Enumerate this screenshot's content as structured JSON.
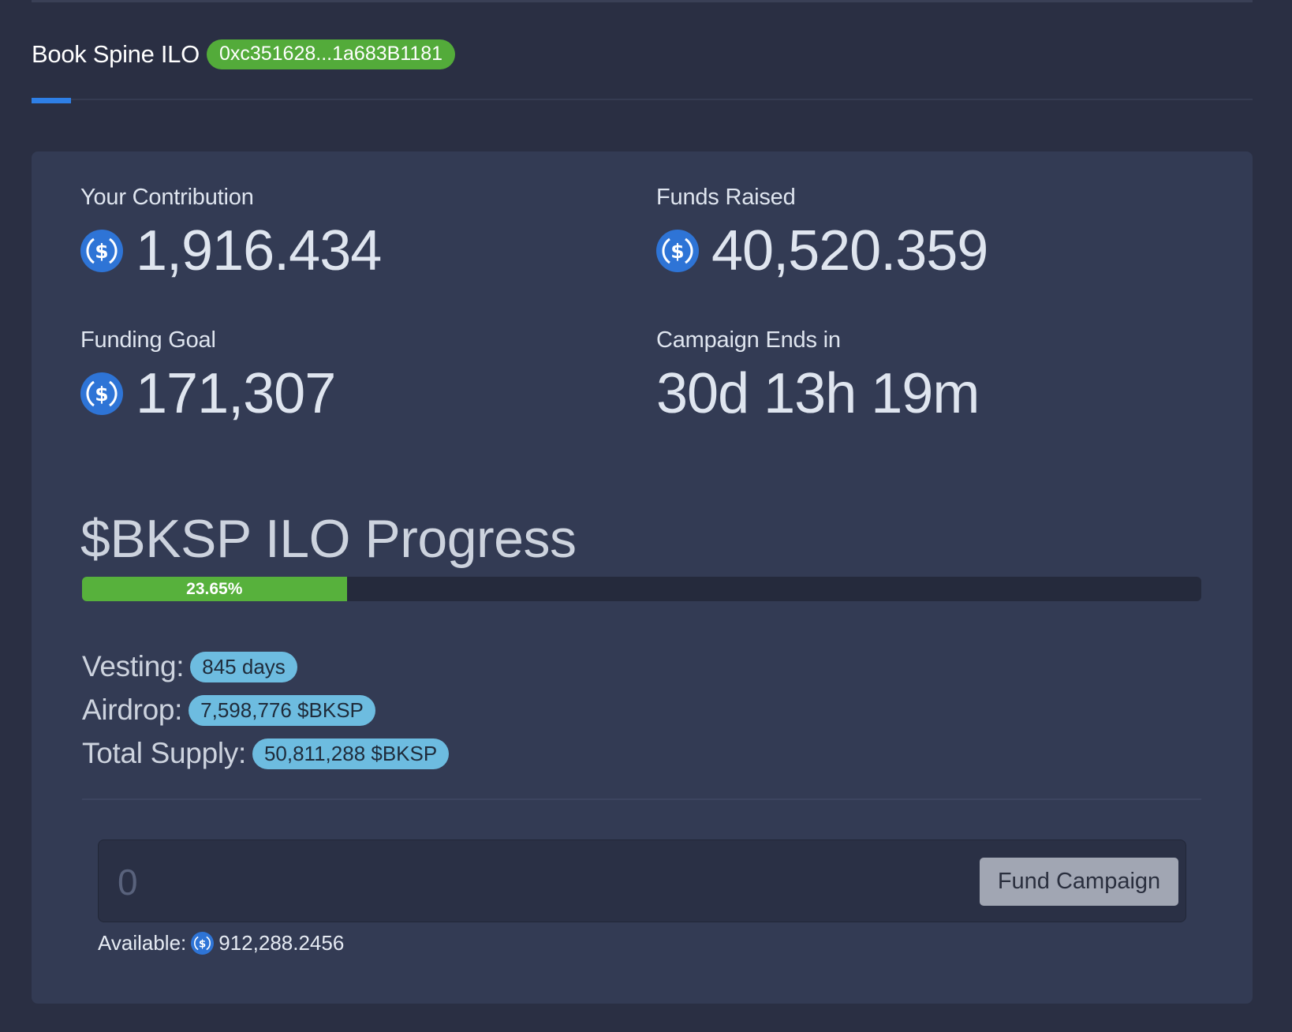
{
  "header": {
    "title": "Book Spine ILO",
    "address": "0xc351628...1a683B1181",
    "badge_color": "#53ab3a",
    "accent_color": "#2e7fe6"
  },
  "stats": {
    "contribution": {
      "label": "Your Contribution",
      "value": "1,916.434",
      "icon": "usdc-coin-icon"
    },
    "funds_raised": {
      "label": "Funds Raised",
      "value": "40,520.359",
      "icon": "usdc-coin-icon"
    },
    "funding_goal": {
      "label": "Funding Goal",
      "value": "171,307",
      "icon": "usdc-coin-icon"
    },
    "campaign_ends": {
      "label": "Campaign Ends in",
      "value": "30d 13h 19m"
    }
  },
  "progress": {
    "title": "$BKSP ILO Progress",
    "percent": 23.65,
    "label": "23.65%",
    "fill_color": "#57b13c"
  },
  "details": {
    "vesting": {
      "label": "Vesting:",
      "value": "845 days"
    },
    "airdrop": {
      "label": "Airdrop:",
      "value": "7,598,776 $BKSP"
    },
    "total_supply": {
      "label": "Total Supply:",
      "value": "50,811,288 $BKSP"
    }
  },
  "fund": {
    "placeholder": "0",
    "button_label": "Fund Campaign",
    "available_label": "Available:",
    "available_value": "912,288.2456"
  }
}
